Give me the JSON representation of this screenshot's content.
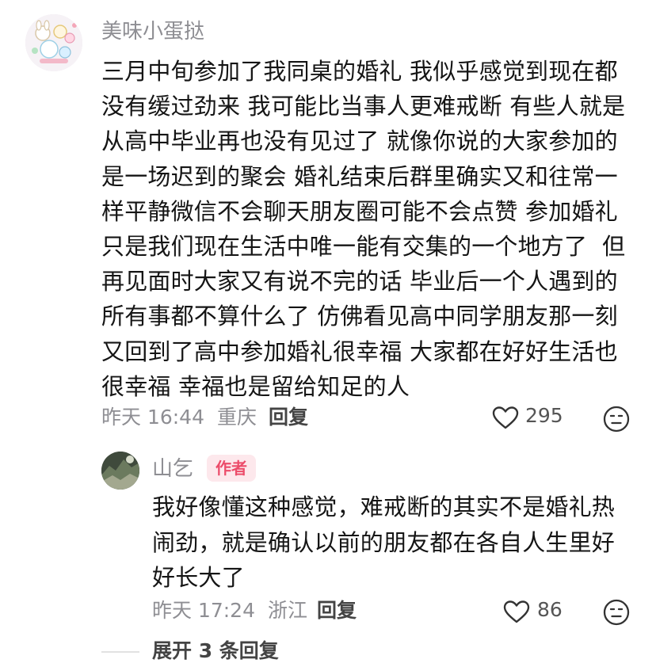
{
  "comment": {
    "username": "美味小蛋挞",
    "text": "三月中旬参加了我同桌的婚礼 我似乎感觉到现在都没有缓过劲来 我可能比当事人更难戒断 有些人就是从高中毕业再也没有见过了 就像你说的大家参加的是一场迟到的聚会 婚礼结束后群里确实又和往常一样平静微信不会聊天朋友圈可能不会点赞 参加婚礼只是我们现在生活中唯一能有交集的一个地方了  但再见面时大家又有说不完的话 毕业后一个人遇到的所有事都不算什么了 仿佛看见高中同学朋友那一刻又回到了高中参加婚礼很幸福 大家都在好好生活也很幸福 幸福也是留给知足的人",
    "date": "昨天 16:44",
    "location": "重庆",
    "reply_label": "回复",
    "like_count": "295",
    "icons": {
      "like": "heart-icon",
      "dislike": "neutral-face-icon"
    }
  },
  "reply": {
    "username": "山乞",
    "badge": "作者",
    "badge_color": "#ec4c6a",
    "text": "我好像懂这种感觉，难戒断的其实不是婚礼热闹劲，就是确认以前的朋友都在各自人生里好好长大了",
    "date": "昨天 17:24",
    "location": "浙江",
    "reply_label": "回复",
    "like_count": "86",
    "icons": {
      "like": "heart-icon",
      "dislike": "neutral-face-icon"
    }
  },
  "expand": {
    "label": "展开 3 条回复"
  }
}
